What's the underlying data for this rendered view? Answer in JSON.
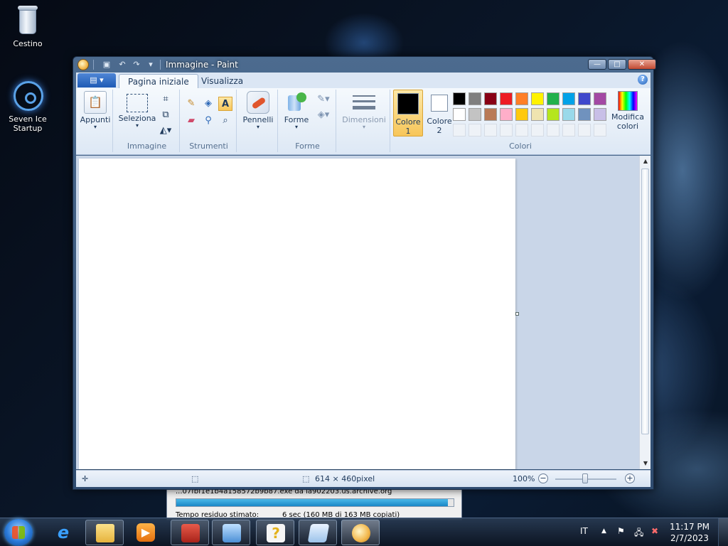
{
  "desktop": {
    "icons": [
      {
        "label": "Cestino",
        "icon": "recycle-bin-icon"
      },
      {
        "label": "Seven Ice\nStartup",
        "icon": "biohazard-shortcut-icon"
      }
    ]
  },
  "download": {
    "filename": "...07fbf1e1b4a158572b9b87.exe da ia902203.us.archive.org",
    "progress_percent": 98,
    "remaining_label": "Tempo residuo stimato:",
    "remaining_value": "6 sec (160 MB di 163 MB copiati)"
  },
  "window": {
    "title": "Immagine - Paint",
    "controls": {
      "minimize": "—",
      "maximize": "□",
      "close": "✕"
    }
  },
  "ribbon": {
    "tabs": [
      {
        "label": "Pagina iniziale",
        "active": true
      },
      {
        "label": "Visualizza",
        "active": false
      }
    ],
    "groups": {
      "clipboard": {
        "button": "Appunti"
      },
      "image": {
        "label": "Immagine",
        "select_button": "Seleziona"
      },
      "tools": {
        "label": "Strumenti"
      },
      "brushes": {
        "button": "Pennelli"
      },
      "shapes": {
        "label": "Forme",
        "button": "Forme"
      },
      "size": {
        "button": "Dimensioni"
      },
      "colors": {
        "label": "Colori",
        "color1": {
          "label": "Colore",
          "sub": "1",
          "value": "#000000"
        },
        "color2": {
          "label": "Colore",
          "sub": "2",
          "value": "#ffffff"
        },
        "edit_button_line1": "Modifica",
        "edit_button_line2": "colori",
        "palette_row1": [
          "#000000",
          "#7f7f7f",
          "#880015",
          "#ed1c24",
          "#ff7f27",
          "#fff200",
          "#22b14c",
          "#00a2e8",
          "#3f48cc",
          "#a349a4"
        ],
        "palette_row2": [
          "#ffffff",
          "#c3c3c3",
          "#b97a57",
          "#ffaec9",
          "#ffc90e",
          "#efe4b0",
          "#b5e61d",
          "#99d9ea",
          "#7092be",
          "#c8bfe7"
        ]
      }
    }
  },
  "statusbar": {
    "size": "614 × 460pixel",
    "zoom": "100%"
  },
  "taskbar": {
    "language": "IT",
    "time": "11:17 PM",
    "date": "2/7/2023"
  }
}
